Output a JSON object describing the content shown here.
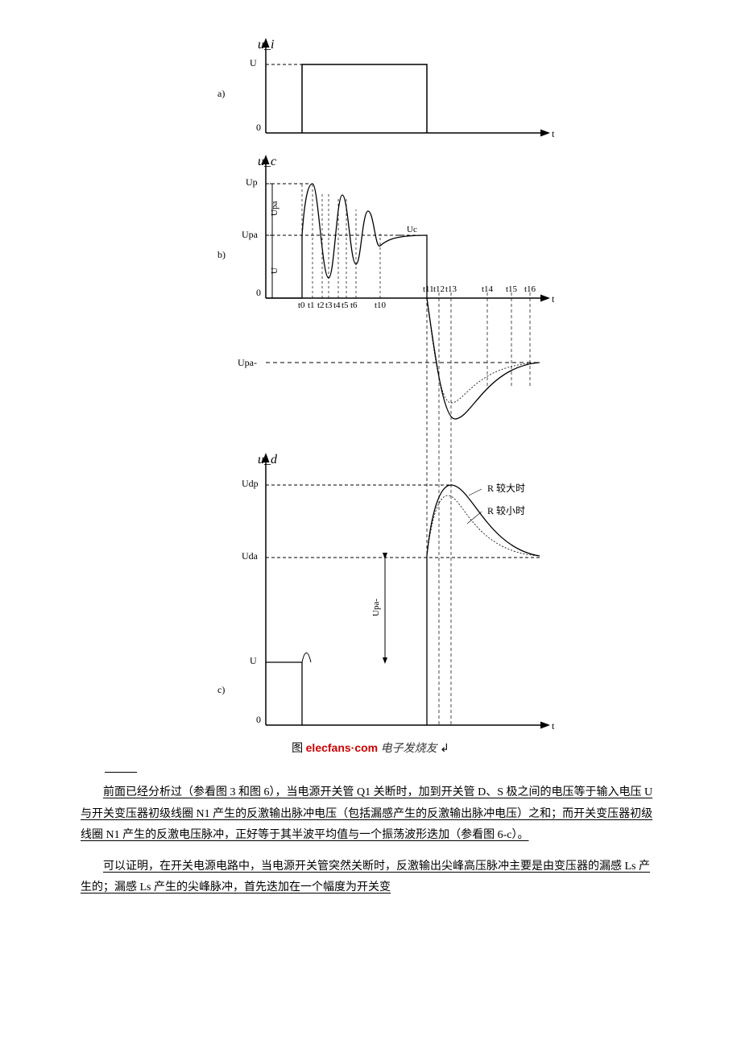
{
  "diagram": {
    "panel_a": {
      "label": "a)",
      "y_axis": "u_i",
      "x_axis": "t",
      "ticks_y": [
        "U",
        "0"
      ]
    },
    "panel_b": {
      "label": "b)",
      "y_axis": "u_c",
      "x_axis": "t",
      "ticks_y": [
        "Up",
        "Upa",
        "0",
        "Upa-"
      ],
      "brackets": [
        "Upa",
        "U"
      ],
      "uc_label": "Uc",
      "t_early": [
        "t0",
        "t1",
        "t2",
        "t3",
        "t4",
        "t5",
        "t6",
        "t10"
      ],
      "t_late": [
        "t11",
        "t12",
        "t13",
        "t14",
        "t15",
        "t16"
      ]
    },
    "panel_c": {
      "label": "c)",
      "y_axis": "u_d",
      "x_axis": "t",
      "ticks_y": [
        "Udp",
        "Uda",
        "U",
        "0"
      ],
      "bracket": "Upa-",
      "annotations": [
        "R 较大时",
        "R 较小时"
      ]
    },
    "caption_prefix": "图",
    "caption_logo": "elecfans·com",
    "caption_tag": "电子发烧友"
  },
  "paragraphs": {
    "p1": "前面已经分析过（参看图 3 和图 6），当电源开关管 Q1 关断时，加到开关管 D、S 极之间的电压等于输入电压 U 与开关变压器初级线圈 N1 产生的反激输出脉冲电压（包括漏感产生的反激输出脉冲电压）之和；而开关变压器初级线圈 N1 产生的反激电压脉冲，正好等于其半波平均值与一个振荡波形迭加（参看图 6-c）。",
    "p2": "可以证明，在开关电源电路中，当电源开关管突然关断时，反激输出尖峰高压脉冲主要是由变压器的漏感 Ls 产生的；漏感 Ls 产生的尖峰脉冲，首先迭加在一个幅度为开关变"
  }
}
